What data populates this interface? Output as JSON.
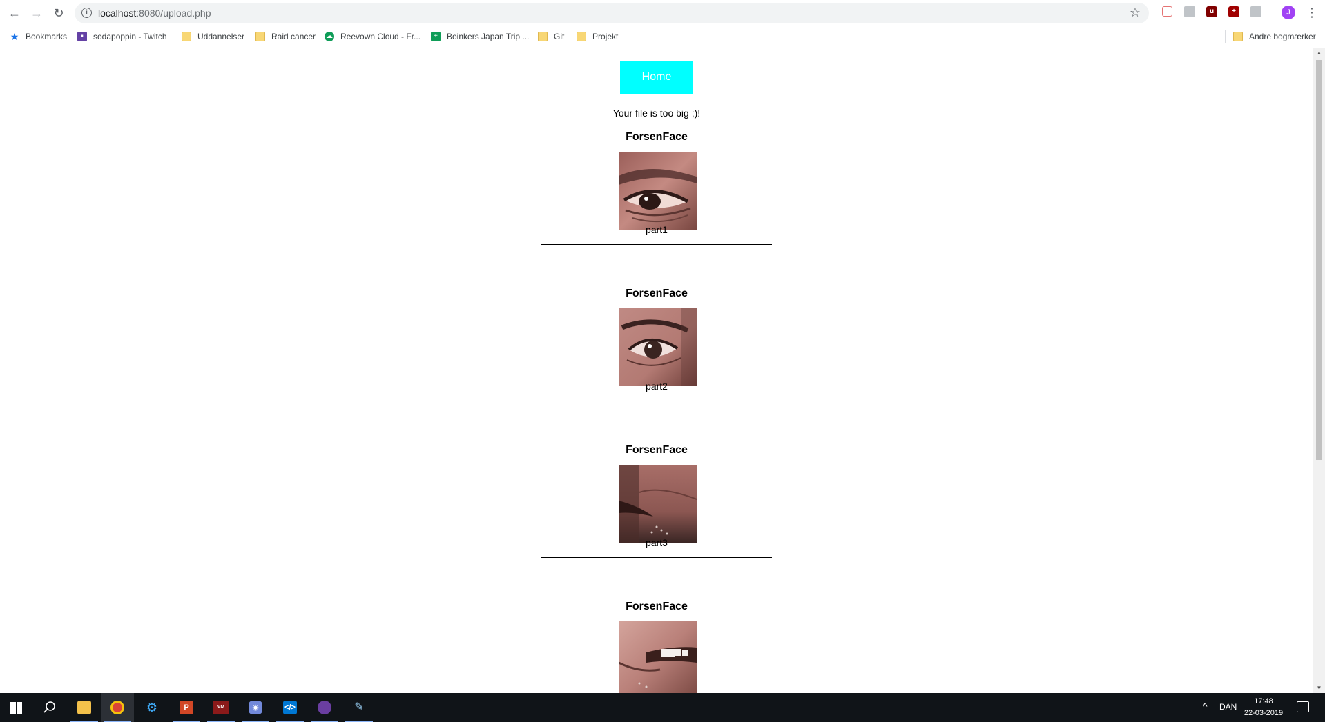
{
  "browser": {
    "url_host": "localhost",
    "url_path": ":8080/upload.php",
    "bookmarks": [
      {
        "label": "Bookmarks",
        "icon": "star-icon"
      },
      {
        "label": "sodapoppin - Twitch",
        "icon": "twitch-icon"
      },
      {
        "label": "Uddannelser",
        "icon": "folder-icon"
      },
      {
        "label": "Raid cancer",
        "icon": "folder-icon"
      },
      {
        "label": "Reevown Cloud - Fr...",
        "icon": "cloud-icon"
      },
      {
        "label": "Boinkers Japan Trip ...",
        "icon": "sheets-icon"
      },
      {
        "label": "Git",
        "icon": "folder-icon"
      },
      {
        "label": "Projekt",
        "icon": "folder-icon"
      }
    ],
    "other_bookmarks": "Andre bogmærker",
    "profile_initial": "J"
  },
  "page": {
    "home_label": "Home",
    "status_message": "Your file is too big ;)!",
    "posts": [
      {
        "title": "ForsenFace",
        "caption": "part1"
      },
      {
        "title": "ForsenFace",
        "caption": "part2"
      },
      {
        "title": "ForsenFace",
        "caption": "part3"
      },
      {
        "title": "ForsenFace",
        "caption": ""
      }
    ]
  },
  "taskbar": {
    "language": "DAN",
    "time": "17:48",
    "date": "22-03-2019"
  },
  "colors": {
    "home_button": "#00ffff",
    "taskbar": "#101418",
    "accent": "#8ab4f8"
  }
}
